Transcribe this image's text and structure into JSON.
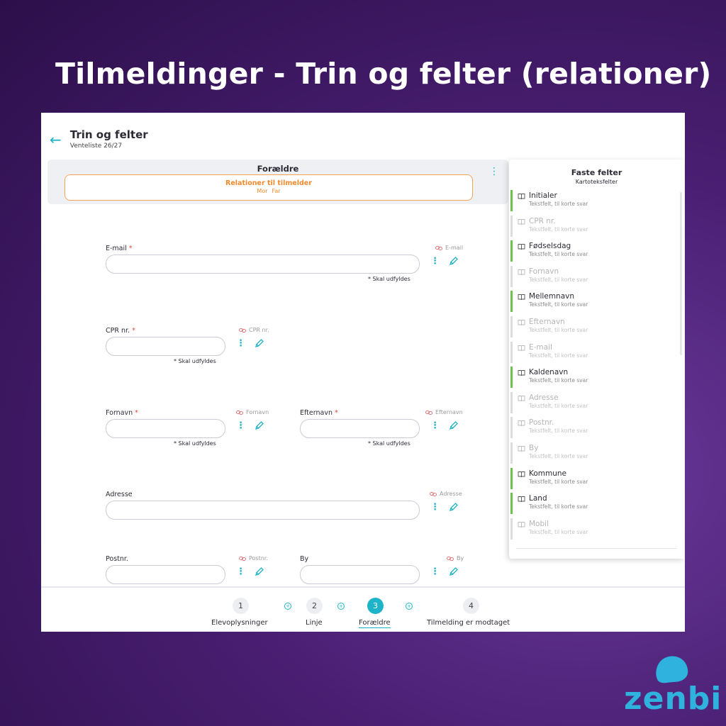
{
  "headline": "Tilmeldinger - Trin og felter (relationer)",
  "page": {
    "title": "Trin og felter",
    "subtitle": "Venteliste 26/27"
  },
  "step_banner": {
    "title": "Forældre",
    "box_title": "Relationer til tilmelder",
    "relations": [
      "Mor",
      "Far"
    ]
  },
  "fields": {
    "email": {
      "label": "E-mail",
      "required_mark": "*",
      "tag": "E-mail",
      "hint": "* Skal udfyldes"
    },
    "cpr": {
      "label": "CPR nr.",
      "required_mark": "*",
      "tag": "CPR nr.",
      "hint": "* Skal udfyldes"
    },
    "fornavn": {
      "label": "Fornavn",
      "required_mark": "*",
      "tag": "Fornavn",
      "hint": "* Skal udfyldes"
    },
    "efternavn": {
      "label": "Efternavn",
      "required_mark": "*",
      "tag": "Efternavn",
      "hint": "* Skal udfyldes"
    },
    "adresse": {
      "label": "Adresse",
      "tag": "Adresse"
    },
    "postnr": {
      "label": "Postnr.",
      "tag": "Postnr."
    },
    "by": {
      "label": "By",
      "tag": "By"
    }
  },
  "side_panel": {
    "title": "Faste felter",
    "subtitle": "Kartoteksfelter",
    "items": [
      {
        "name": "Initialer",
        "desc": "Tekstfelt, til korte svar",
        "active": true
      },
      {
        "name": "CPR nr.",
        "desc": "Tekstfelt, til korte svar",
        "active": false
      },
      {
        "name": "Fødselsdag",
        "desc": "Tekstfelt, til korte svar",
        "active": true
      },
      {
        "name": "Fornavn",
        "desc": "Tekstfelt, til korte svar",
        "active": false
      },
      {
        "name": "Mellemnavn",
        "desc": "Tekstfelt, til korte svar",
        "active": true
      },
      {
        "name": "Efternavn",
        "desc": "Tekstfelt, til korte svar",
        "active": false
      },
      {
        "name": "E-mail",
        "desc": "Tekstfelt, til korte svar",
        "active": false
      },
      {
        "name": "Kaldenavn",
        "desc": "Tekstfelt, til korte svar",
        "active": true
      },
      {
        "name": "Adresse",
        "desc": "Tekstfelt, til korte svar",
        "active": false
      },
      {
        "name": "Postnr.",
        "desc": "Tekstfelt, til korte svar",
        "active": false
      },
      {
        "name": "By",
        "desc": "Tekstfelt, til korte svar",
        "active": false
      },
      {
        "name": "Kommune",
        "desc": "Tekstfelt, til korte svar",
        "active": true
      },
      {
        "name": "Land",
        "desc": "Tekstfelt, til korte svar",
        "active": true
      },
      {
        "name": "Mobil",
        "desc": "Tekstfelt, til korte svar",
        "active": false
      }
    ]
  },
  "stepper": {
    "steps": [
      {
        "number": "1",
        "label": "Elevoplysninger"
      },
      {
        "number": "2",
        "label": "Linje"
      },
      {
        "number": "3",
        "label": "Forældre"
      },
      {
        "number": "4",
        "label": "Tilmelding er modtaget"
      }
    ],
    "current_step": 3
  },
  "brand": {
    "name": "zenbi",
    "color": "#2fb2dd"
  },
  "colors": {
    "accent": "#1fb3c9",
    "orange": "#f08a2c",
    "active_bar": "#6cc24a",
    "required": "#e0453c"
  },
  "icons": {
    "back": "arrow-left-icon",
    "menu": "kebab-icon",
    "edit": "pencil-icon",
    "link": "link-icon",
    "field": "book-icon"
  }
}
